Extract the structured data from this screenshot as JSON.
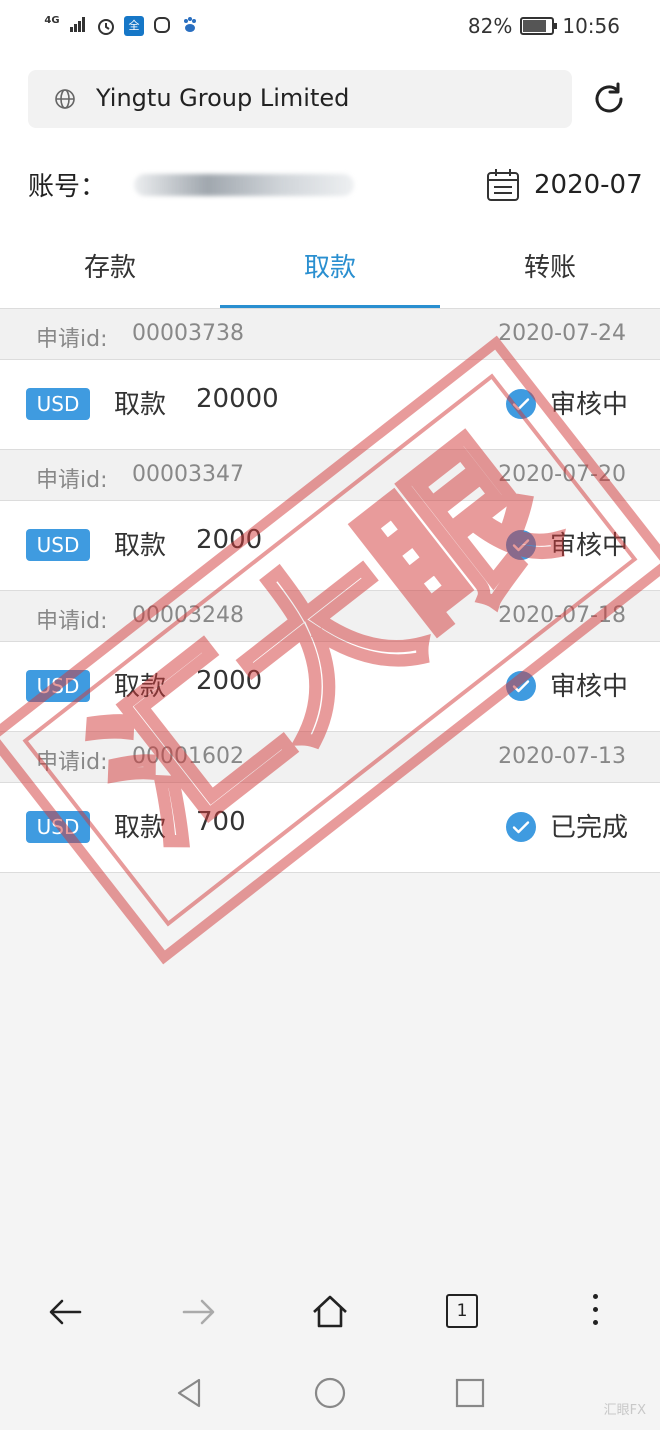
{
  "status_bar": {
    "network": "4G",
    "battery_text": "82%",
    "battery_level": 0.82,
    "time": "10:56",
    "sq_icon_text": "全"
  },
  "url_bar": {
    "title": "Yingtu Group Limited"
  },
  "account": {
    "label": "账号："
  },
  "month": "2020-07",
  "tabs": [
    {
      "label": "存款",
      "active": false
    },
    {
      "label": "取款",
      "active": true
    },
    {
      "label": "转账",
      "active": false
    }
  ],
  "records": [
    {
      "id_label": "申请id:",
      "id": "00003738",
      "date": "2020-07-24",
      "currency": "USD",
      "type": "取款",
      "amount": "20000",
      "status": "审核中"
    },
    {
      "id_label": "申请id:",
      "id": "00003347",
      "date": "2020-07-20",
      "currency": "USD",
      "type": "取款",
      "amount": "2000",
      "status": "审核中"
    },
    {
      "id_label": "申请id:",
      "id": "00003248",
      "date": "2020-07-18",
      "currency": "USD",
      "type": "取款",
      "amount": "2000",
      "status": "审核中"
    },
    {
      "id_label": "申请id:",
      "id": "00001602",
      "date": "2020-07-13",
      "currency": "USD",
      "type": "取款",
      "amount": "700",
      "status": "已完成"
    }
  ],
  "browser_nav": {
    "tab_count": "1"
  },
  "watermark": {
    "stamp_text": "汇大眼",
    "corner_text": "汇眼FX"
  },
  "colors": {
    "accent": "#2a8fd0",
    "badge": "#3f9be0",
    "stamp": "#d23a3a"
  }
}
